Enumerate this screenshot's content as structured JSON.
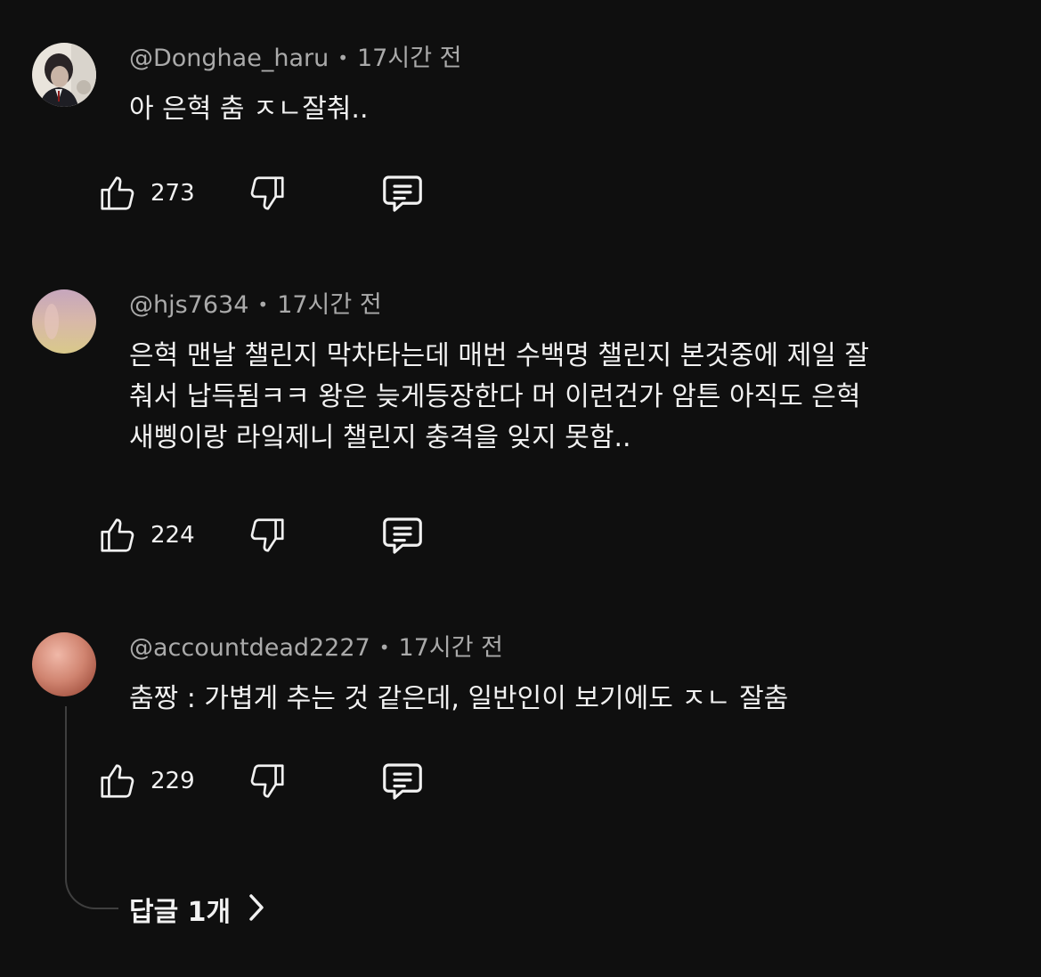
{
  "comments": [
    {
      "author": "@Donghae_haru",
      "separator": "•",
      "time": "17시간 전",
      "text": "아 은혁 춤 ㅈㄴ잘춰..",
      "likes": "273",
      "avatar_colors": [
        "#e9e4dc",
        "#2a2a2e"
      ]
    },
    {
      "author": "@hjs7634",
      "separator": "•",
      "time": "17시간 전",
      "text": "은혁 맨날 챌린지 막차타는데 매번 수백명 챌린지 본것중에 제일 잘\n춰서 납득됨ㅋㅋ 왕은 늦게등장한다 머 이런건가 암튼 아직도 은혁\n새삥이랑 라잌제니 챌린지 충격을 잊지 못함..",
      "likes": "224",
      "avatar_colors": [
        "#c9a7b8",
        "#d9c58e"
      ]
    },
    {
      "author": "@accountdead2227",
      "separator": "•",
      "time": "17시간 전",
      "text": "춤짱 : 가볍게 추는 것 같은데, 일반인이 보기에도 ㅈㄴ 잘춤",
      "likes": "229",
      "avatar_colors": [
        "#e8a99a",
        "#b4624f"
      ]
    }
  ],
  "replies_toggle": {
    "label": "답글 1개"
  },
  "icons": {
    "like": "thumbs-up-icon",
    "dislike": "thumbs-down-icon",
    "reply": "comment-icon",
    "expand": "chevron-right-icon"
  },
  "colors": {
    "background": "#0f0f0f",
    "primary_text": "#f1f1f1",
    "secondary_text": "#aaaaaa",
    "thread_line": "#3f3f3f"
  }
}
